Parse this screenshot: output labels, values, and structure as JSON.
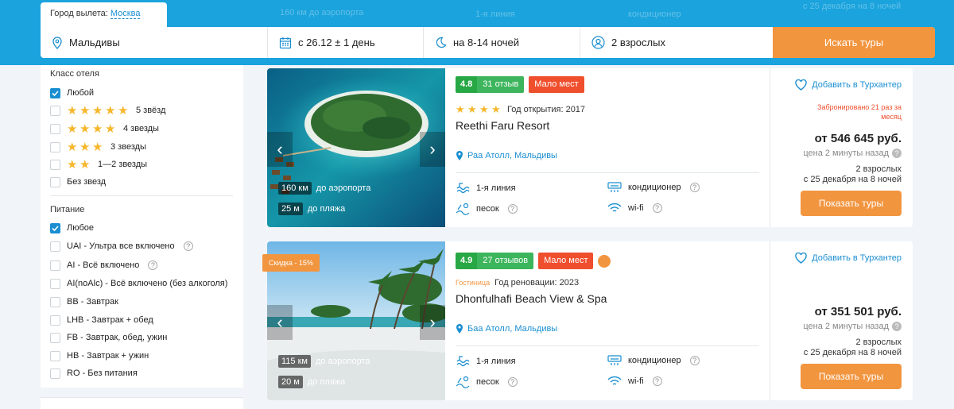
{
  "header": {
    "city_label": "Город вылета:",
    "city_value": "Москва",
    "destination": "Мальдивы",
    "dates": "с 26.12 ± 1 день",
    "nights": "на 8-14 ночей",
    "guests": "2 взрослых",
    "search_button": "Искать туры",
    "ghost_left": "160 км до аэропорта",
    "ghost_mid1": "1-я линия",
    "ghost_mid2": "кондиционер",
    "ghost_right": "с 25 декабря на 8 ночей"
  },
  "sidebar": {
    "hotel_class_title": "Класс отеля",
    "hotel_class": [
      {
        "label": "Любой",
        "checked": true,
        "stars": 0
      },
      {
        "label": "5 звёзд",
        "checked": false,
        "stars": 5
      },
      {
        "label": "4 звезды",
        "checked": false,
        "stars": 4
      },
      {
        "label": "3 звезды",
        "checked": false,
        "stars": 3
      },
      {
        "label": "1—2 звезды",
        "checked": false,
        "stars": 2
      },
      {
        "label": "Без звезд",
        "checked": false,
        "stars": 0
      }
    ],
    "meals_title": "Питание",
    "meals": [
      {
        "label": "Любое",
        "checked": true
      },
      {
        "label": "UAI - Ультра все включено",
        "checked": false,
        "help": true
      },
      {
        "label": "AI - Всё включено",
        "checked": false,
        "help": true
      },
      {
        "label": "AI(noAlc) - Всё включено (без алкоголя)",
        "checked": false
      },
      {
        "label": "BB - Завтрак",
        "checked": false
      },
      {
        "label": "LHB - Завтрак + обед",
        "checked": false
      },
      {
        "label": "FB - Завтрак, обед, ужин",
        "checked": false
      },
      {
        "label": "HB - Завтрак + ужин",
        "checked": false
      },
      {
        "label": "RO - Без питания",
        "checked": false
      }
    ],
    "help_glyph": "?"
  },
  "hotels": [
    {
      "rating": "4.8",
      "reviews": "31 отзыв",
      "few_places": "Мало мест",
      "stars": 4,
      "meta_label": "Год открытия: 2017",
      "name": "Reethi Faru Resort",
      "location": "Раа Атолл, Мальдивы",
      "dist_airport_value": "160 км",
      "dist_airport_label": "до аэропорта",
      "dist_beach_value": "25 м",
      "dist_beach_label": "до пляжа",
      "features": [
        "1-я линия",
        "кондиционер",
        "песок",
        "wi-fi"
      ],
      "favorite": "Добавить в Турхантер",
      "booked": "Забронировано 21 раз за месяц",
      "price": "от 546 645 руб.",
      "price_age": "цена 2 минуты назад",
      "people": "2 взрослых",
      "dates": "с 25 декабря на 8 ночей",
      "button": "Показать туры"
    },
    {
      "rating": "4.9",
      "reviews": "27 отзывов",
      "few_places": "Мало мест",
      "discount": "Скидка - 15%",
      "type_tag": "Гостиница",
      "meta_label": "Год реновации: 2023",
      "name": "Dhonfulhafi Beach View & Spa",
      "location": "Баа Атолл, Мальдивы",
      "dist_airport_value": "115 км",
      "dist_airport_label": "до аэропорта",
      "dist_beach_value": "20 м",
      "dist_beach_label": "до пляжа",
      "features": [
        "1-я линия",
        "кондиционер",
        "песок",
        "wi-fi"
      ],
      "favorite": "Добавить в Турхантер",
      "price": "от 351 501 руб.",
      "price_age": "цена 2 минуты назад",
      "people": "2 взрослых",
      "dates": "с 25 декабря на 8 ночей",
      "button": "Показать туры"
    }
  ],
  "colors": {
    "accent": "#1aa3dd",
    "orange": "#f2953f",
    "green": "#28a745",
    "red": "#f04f2e"
  }
}
